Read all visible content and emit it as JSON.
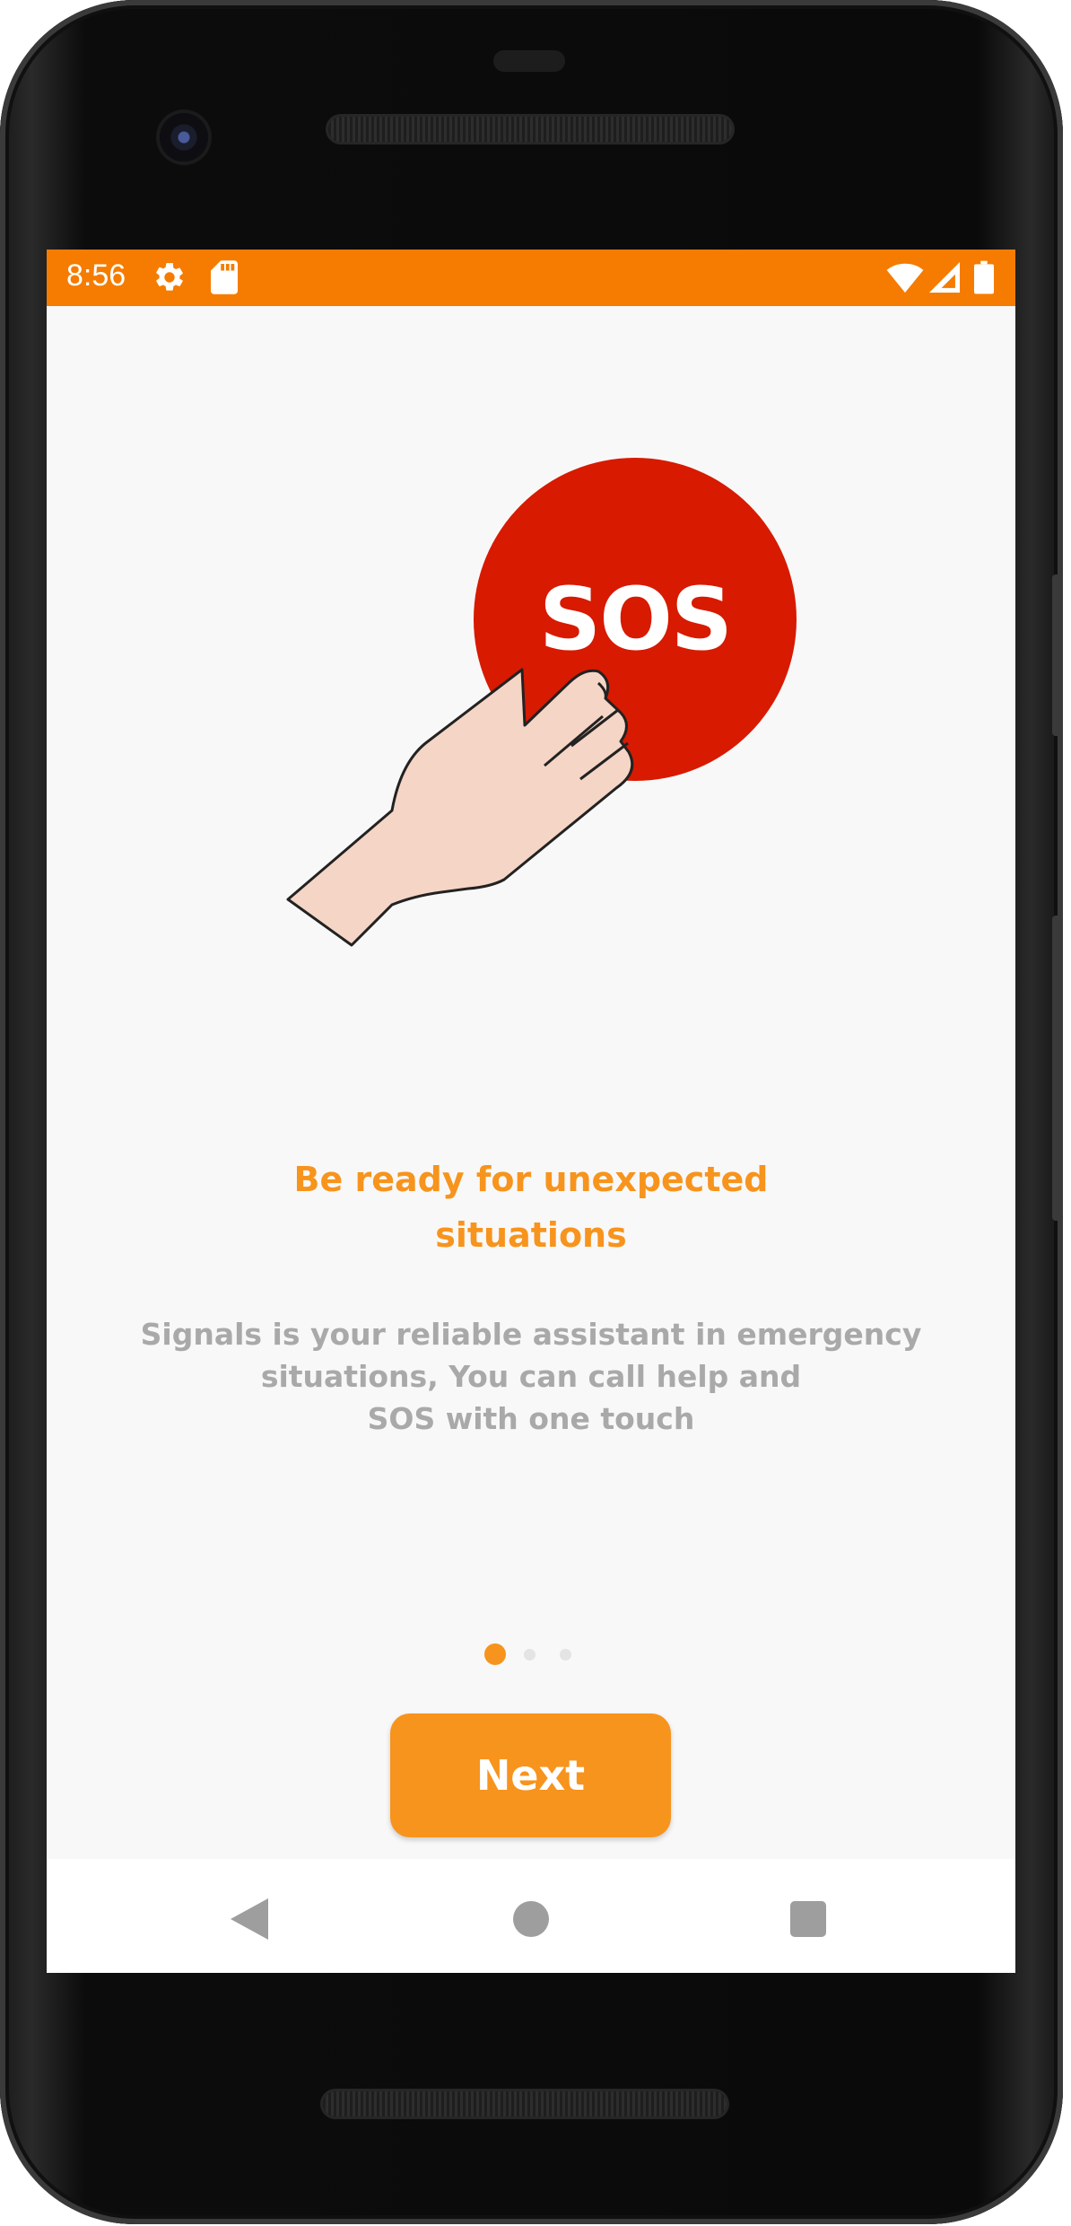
{
  "status_bar": {
    "time": "8:56",
    "background_color": "#f57c00",
    "icons": [
      "settings-icon",
      "sd-card-icon",
      "wifi-icon",
      "cell-signal-icon",
      "battery-icon"
    ]
  },
  "illustration": {
    "button_text": "SOS",
    "button_color": "#d71a00",
    "hand_color": "#f5d5c5"
  },
  "onboarding": {
    "title_lines": [
      "Be ready for unexpected",
      "situations"
    ],
    "description_lines": [
      "Signals is your reliable assistant in emergency",
      "situations, You can call help and",
      "SOS with one touch"
    ],
    "page_indicator": {
      "current": 1,
      "total": 3
    },
    "next_label": "Next",
    "accent_color": "#f7941d"
  },
  "nav_bar": {
    "buttons": [
      "back-icon",
      "home-icon",
      "recents-icon"
    ]
  }
}
